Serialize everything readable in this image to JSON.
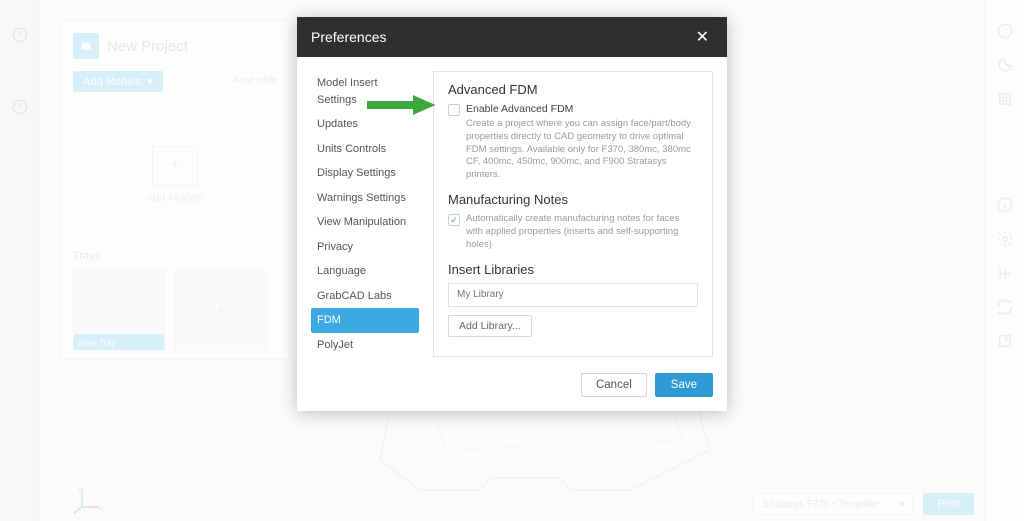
{
  "app": {
    "project_title": "New Project",
    "add_models": "Add Models",
    "assemble": "Assemble",
    "drop_label": "Add Models",
    "trays": "Trays",
    "tray_active": "New Tray",
    "printer": "Stratasys F370 • Template",
    "print_btn": "Print"
  },
  "modal": {
    "title": "Preferences",
    "nav": {
      "i0": "Model Insert Settings",
      "i1": "Updates",
      "i2": "Units Controls",
      "i3": "Display Settings",
      "i4": "Warnings Settings",
      "i5": "View Manipulation",
      "i6": "Privacy",
      "i7": "Language",
      "i8": "GrabCAD Labs",
      "i9": "FDM",
      "i10": "PolyJet"
    },
    "section1_title": "Advanced FDM",
    "check1_label": "Enable Advanced FDM",
    "check1_desc": "Create a project where you can assign face/part/body properties directly to CAD geometry to drive optimal FDM settings. Available only for F370, 380mc, 380mc CF, 400mc, 450mc, 900mc, and F900 Stratasys printers.",
    "section2_title": "Manufacturing Notes",
    "check2_label": "Automatically create manufacturing notes for faces with applied properties (inserts and self-supporting holes)",
    "section3_title": "Insert Libraries",
    "lib_placeholder": "My Library",
    "add_lib": "Add Library...",
    "cancel": "Cancel",
    "save": "Save"
  }
}
